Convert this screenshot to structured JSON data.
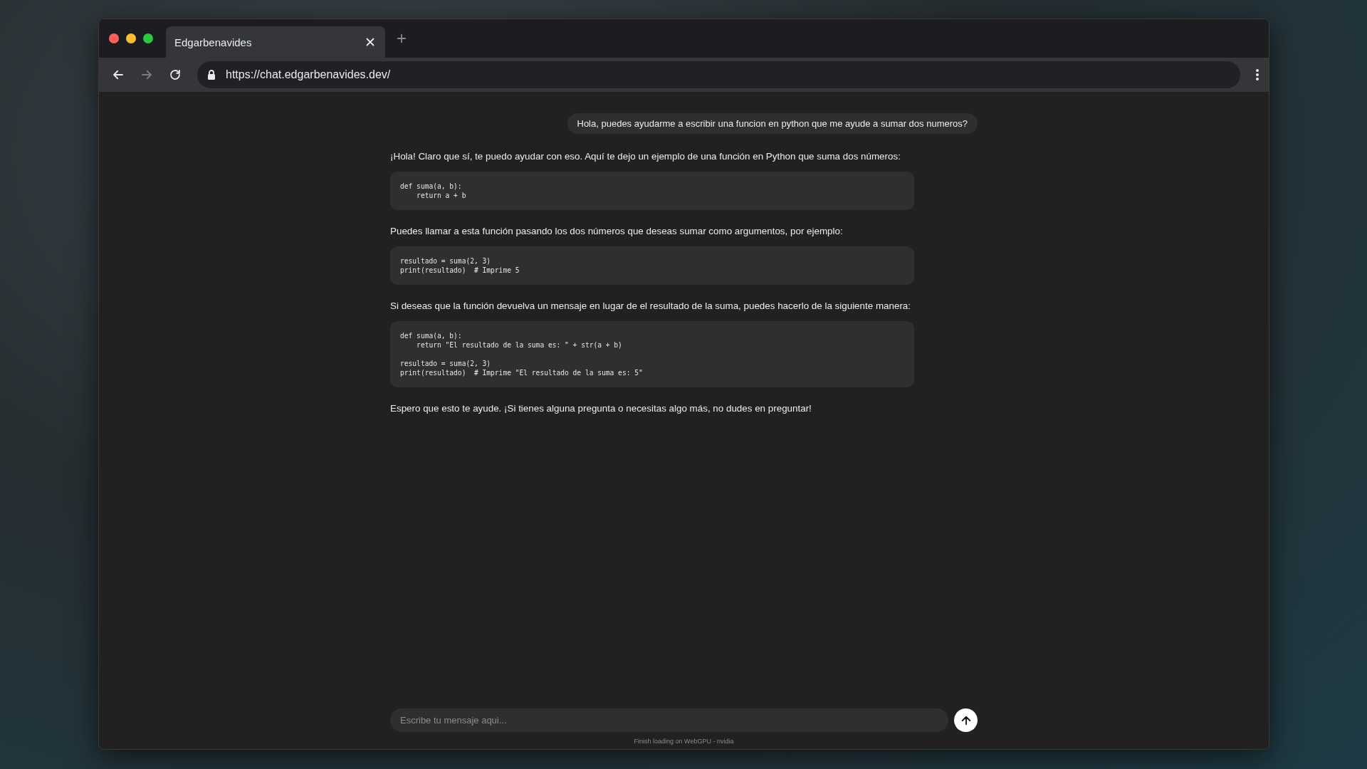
{
  "browser": {
    "tab": {
      "title": "Edgarbenavides",
      "selected": true
    },
    "url": "https://chat.edgarbenavides.dev/"
  },
  "messages": [
    {
      "kind": "user",
      "text": "Hola, puedes ayudarme a escribir una funcion en python que me ayude a sumar dos numeros?"
    },
    {
      "kind": "text",
      "text": "¡Hola! Claro que sí, te puedo ayudar con eso. Aquí te dejo un ejemplo de una función en Python que suma dos números:"
    },
    {
      "kind": "code",
      "text": "def suma(a, b):\n    return a + b"
    },
    {
      "kind": "text",
      "text": "Puedes llamar a esta función pasando los dos números que deseas sumar como argumentos, por ejemplo:"
    },
    {
      "kind": "code",
      "text": "resultado = suma(2, 3)\nprint(resultado)  # Imprime 5"
    },
    {
      "kind": "text",
      "text": "Si deseas que la función devuelva un mensaje en lugar de el resultado de la suma, puedes hacerlo de la siguiente manera:"
    },
    {
      "kind": "code",
      "text": "def suma(a, b):\n    return \"El resultado de la suma es: \" + str(a + b)\n\nresultado = suma(2, 3)\nprint(resultado)  # Imprime \"El resultado de la suma es: 5\""
    },
    {
      "kind": "text",
      "text": "Espero que esto te ayude. ¡Si tienes alguna pregunta o necesitas algo más, no dudes en preguntar!"
    }
  ],
  "composer": {
    "placeholder": "Escribe tu mensaje aqui..."
  },
  "footer": "Finish loading on WebGPU - nvidia"
}
